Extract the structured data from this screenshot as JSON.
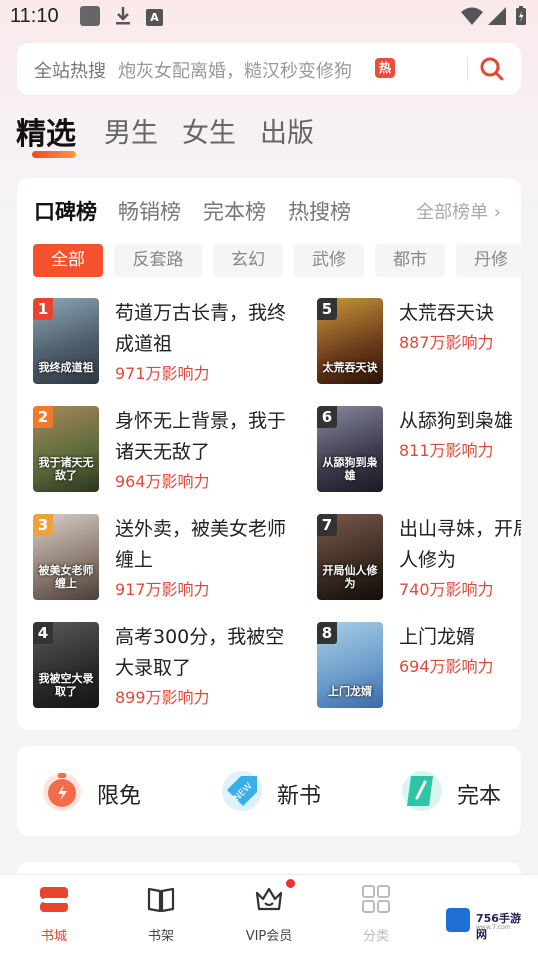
{
  "status_bar": {
    "time": "11:10",
    "a_label": "A"
  },
  "search": {
    "prefix": "全站热搜",
    "hint": "炮灰女配离婚，糙汉秒变修狗",
    "hot_badge": "热"
  },
  "top_tabs": [
    "精选",
    "男生",
    "女生",
    "出版"
  ],
  "rank_card": {
    "tabs": [
      "口碑榜",
      "畅销榜",
      "完本榜",
      "热搜榜"
    ],
    "all_lists_label": "全部榜单 ›",
    "chips": [
      "全部",
      "反套路",
      "玄幻",
      "武修",
      "都市",
      "丹修"
    ],
    "books": [
      {
        "rank": "1",
        "title": "苟道万古长青，我终成道祖",
        "influence": "971万影响力",
        "cover_text": "我终成道祖",
        "rank_color": "#e8442e"
      },
      {
        "rank": "2",
        "title": "身怀无上背景，我于诸天无敌了",
        "influence": "964万影响力",
        "cover_text": "我于诸天无敌了",
        "rank_color": "#f07a2a"
      },
      {
        "rank": "3",
        "title": "送外卖，被美女老师缠上",
        "influence": "917万影响力",
        "cover_text": "被美女老师缠上",
        "rank_color": "#f0a23a"
      },
      {
        "rank": "4",
        "title": "高考300分，我被空大录取了",
        "influence": "899万影响力",
        "cover_text": "我被空大录取了",
        "rank_color": "#333333"
      },
      {
        "rank": "5",
        "title": "太荒吞天诀",
        "influence": "887万影响力",
        "cover_text": "太荒吞天诀",
        "rank_color": "#333333"
      },
      {
        "rank": "6",
        "title": "从舔狗到枭雄",
        "influence": "811万影响力",
        "cover_text": "从舔狗到枭雄",
        "rank_color": "#333333"
      },
      {
        "rank": "7",
        "title": "出山寻妹，开局光仙人修为",
        "influence": "740万影响力",
        "cover_text": "开局仙人修为",
        "rank_color": "#333333"
      },
      {
        "rank": "8",
        "title": "上门龙婿",
        "influence": "694万影响力",
        "cover_text": "上门龙婿",
        "rank_color": "#333333"
      }
    ]
  },
  "categories": [
    {
      "label": "限免",
      "icon": "timer-icon",
      "color": "#f26b4a"
    },
    {
      "label": "新书",
      "icon": "new-tag-icon",
      "color": "#3aaee8"
    },
    {
      "label": "完本",
      "icon": "book-complete-icon",
      "color": "#2ec4a6"
    }
  ],
  "bottom_nav": [
    {
      "label": "书城",
      "icon": "bookstore-icon",
      "active": true
    },
    {
      "label": "书架",
      "icon": "bookshelf-icon",
      "active": false
    },
    {
      "label": "VIP会员",
      "icon": "vip-crown-icon",
      "active": false
    },
    {
      "label": "分类",
      "icon": "category-grid-icon",
      "active": false
    }
  ],
  "watermark": {
    "text": "756手游网",
    "sub": "www.7.com"
  },
  "colors": {
    "accent": "#e8442e",
    "influence": "#e04a3a"
  }
}
